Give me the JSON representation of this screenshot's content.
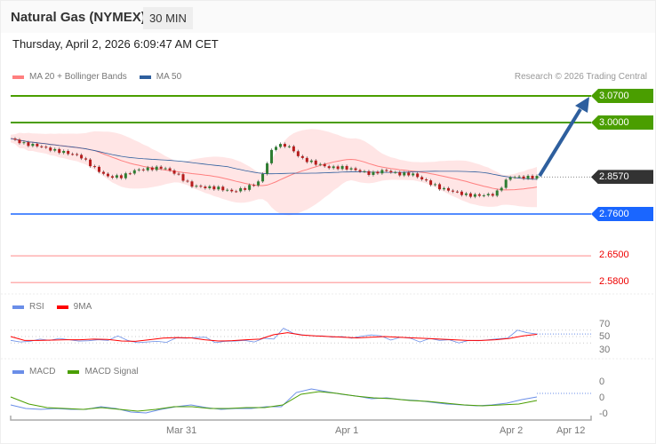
{
  "header": {
    "title": "Natural Gas (NYMEX)",
    "timeframe": "30 MIN",
    "datetime": "Thursday, April 2, 2026 6:09:47 AM CET",
    "credit": "Research © 2026 Trading Central"
  },
  "legend": {
    "ma20": "MA 20 + Bollinger Bands",
    "ma50": "MA 50",
    "rsi": "RSI",
    "rsi_ma": "9MA",
    "macd": "MACD",
    "macd_signal": "MACD Signal"
  },
  "colors": {
    "resistance": "#4a9e00",
    "current": "#333333",
    "support": "#1a66ff",
    "target": "#e00000",
    "arrow": "#2e5f9e",
    "ma20": "#ff7f7f",
    "ma50": "#2e5f9e",
    "rsi": "#6a8ee8",
    "rsi_ma": "#ff0000",
    "signal": "#4a9e00"
  },
  "levels": [
    {
      "label": "3.0700",
      "value": 3.07,
      "kind": "resistance"
    },
    {
      "label": "3.0000",
      "value": 3.0,
      "kind": "resistance"
    },
    {
      "label": "2.8570",
      "value": 2.857,
      "kind": "current"
    },
    {
      "label": "2.7600",
      "value": 2.76,
      "kind": "support"
    },
    {
      "label": "2.6500",
      "value": 2.65,
      "kind": "target"
    },
    {
      "label": "2.5800",
      "value": 2.58,
      "kind": "target"
    }
  ],
  "rsi_axis": [
    "70",
    "50",
    "30"
  ],
  "macd_axis": [
    "0",
    "0",
    "-0"
  ],
  "x_axis": [
    "Mar 31",
    "Apr 1",
    "Apr 2",
    "Apr 12"
  ],
  "chart_data": {
    "type": "candlestick",
    "price_keypoints": [
      2.958,
      2.944,
      2.939,
      2.928,
      2.921,
      2.912,
      2.882,
      2.858,
      2.858,
      2.875,
      2.879,
      2.882,
      2.865,
      2.835,
      2.83,
      2.828,
      2.819,
      2.828,
      2.846,
      2.94,
      2.94,
      2.905,
      2.893,
      2.882,
      2.882,
      2.875,
      2.865,
      2.875,
      2.865,
      2.865,
      2.846,
      2.828,
      2.819,
      2.809,
      2.809,
      2.812,
      2.858,
      2.856,
      2.857
    ],
    "rsi": [
      38,
      33,
      35,
      42,
      38,
      44,
      40,
      36,
      37,
      40,
      38,
      52,
      38,
      31,
      33,
      35,
      32,
      46,
      45,
      47,
      48,
      31,
      35,
      36,
      38,
      33,
      45,
      42,
      76,
      60,
      55,
      52,
      52,
      48,
      50,
      45,
      51,
      55,
      52,
      39,
      48,
      45,
      33,
      44,
      38,
      40,
      30,
      38,
      37,
      40,
      43,
      45,
      70,
      62,
      58
    ],
    "rsi_ma": [
      50,
      38,
      38,
      39,
      40,
      40,
      42,
      41,
      36,
      35,
      40,
      45,
      47,
      46,
      40,
      36,
      37,
      40,
      42,
      56,
      62,
      55,
      52,
      50,
      48,
      46,
      48,
      50,
      48,
      46,
      44,
      42,
      40,
      38,
      38,
      40,
      44,
      52,
      57
    ],
    "macd": [
      -0.8,
      -1.2,
      -1.3,
      -1.2,
      -1.3,
      -1.3,
      -1.0,
      -1.2,
      -1.6,
      -1.7,
      -1.3,
      -1.0,
      -0.8,
      -1.1,
      -1.3,
      -1.2,
      -1.2,
      -1.0,
      -1.0,
      0.6,
      1.0,
      0.7,
      0.4,
      0.2,
      -0.1,
      0.0,
      -0.2,
      -0.3,
      -0.5,
      -0.7,
      -0.8,
      -0.9,
      -0.8,
      -0.6,
      -0.2,
      0.1
    ],
    "macd_signal": [
      0.1,
      -0.7,
      -1.1,
      -1.2,
      -1.3,
      -1.1,
      -1.3,
      -1.5,
      -1.3,
      -1.0,
      -1.0,
      -1.2,
      -1.2,
      -1.1,
      -1.1,
      -0.8,
      0.4,
      0.7,
      0.5,
      0.2,
      0.0,
      -0.1,
      -0.3,
      -0.4,
      -0.6,
      -0.8,
      -0.9,
      -0.8,
      -0.7,
      -0.3
    ],
    "forecast_target": 3.07
  }
}
